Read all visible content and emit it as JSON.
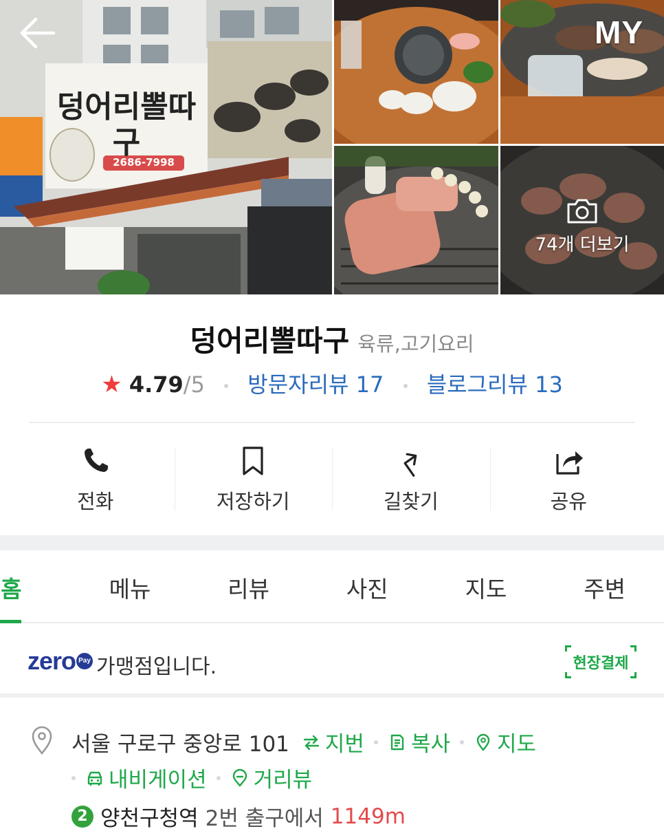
{
  "header": {
    "my_label": "MY",
    "more_photos_label": "74개 더보기",
    "signboard": {
      "name": "덩어리뽈따구",
      "phone": "2686-7998"
    }
  },
  "place": {
    "name": "덩어리뽈따구",
    "category": "육류,고기요리",
    "rating": "4.79",
    "rating_max": "/5",
    "visitor_reviews": "방문자리뷰 17",
    "blog_reviews": "블로그리뷰 13"
  },
  "actions": [
    {
      "label": "전화",
      "icon": "phone-icon"
    },
    {
      "label": "저장하기",
      "icon": "bookmark-icon"
    },
    {
      "label": "길찾기",
      "icon": "directions-icon"
    },
    {
      "label": "공유",
      "icon": "share-icon"
    }
  ],
  "tabs": [
    {
      "label": "홈",
      "active": true
    },
    {
      "label": "메뉴"
    },
    {
      "label": "리뷰"
    },
    {
      "label": "사진"
    },
    {
      "label": "지도"
    },
    {
      "label": "주변"
    }
  ],
  "zeropay": {
    "logo": "zero",
    "logo_badge": "Pay",
    "text": "가맹점입니다.",
    "onsite_label": "현장결제"
  },
  "address": {
    "road": "서울 구로구 중앙로 101",
    "lot_label": "지번",
    "copy_label": "복사",
    "map_label": "지도",
    "navi_label": "내비게이션",
    "streetview_label": "거리뷰",
    "subway_line": "2",
    "station": "양천구청역",
    "exit": "2번 출구에서",
    "distance": "1149m"
  },
  "colors": {
    "accent_green": "#1fa84a",
    "link_blue": "#2a6bbd",
    "star_red": "#f03b3b",
    "distance_red": "#e34b4b",
    "zeropay_navy": "#263b95",
    "line2_green": "#33a23d"
  }
}
